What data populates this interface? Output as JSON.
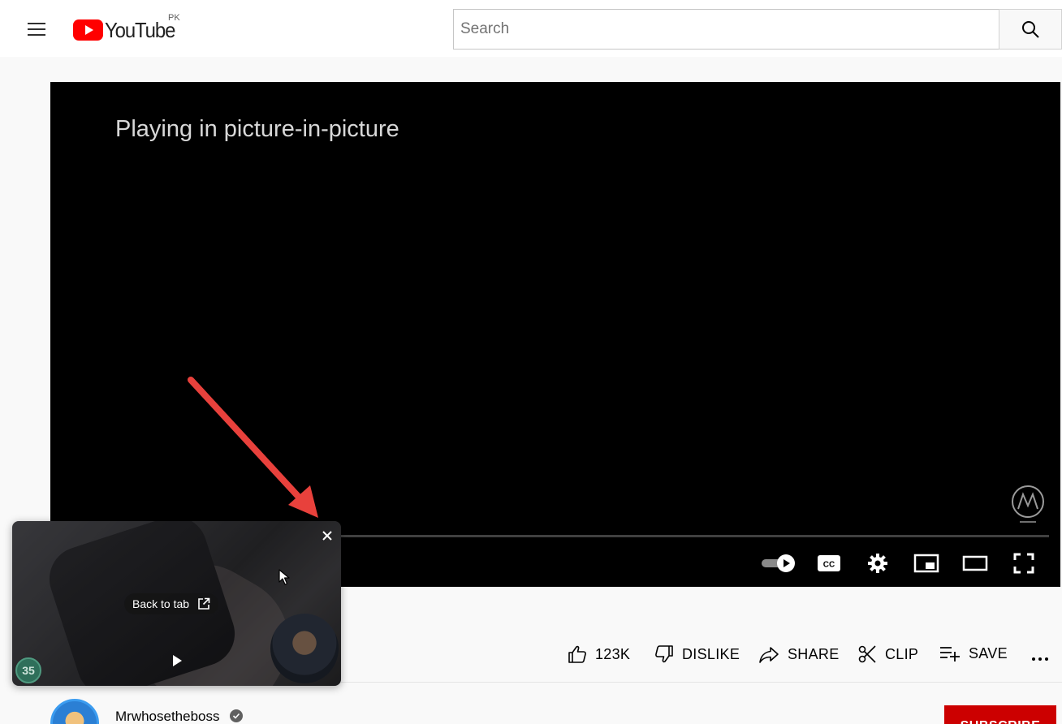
{
  "header": {
    "logo_text": "YouTube",
    "country_code": "PK",
    "search_placeholder": "Search"
  },
  "player": {
    "pip_message": "Playing in picture-in-picture"
  },
  "actions": {
    "like_count": "123K",
    "dislike_label": "DISLIKE",
    "share_label": "SHARE",
    "clip_label": "CLIP",
    "save_label": "SAVE"
  },
  "channel": {
    "name": "Mrwhosetheboss",
    "subscribe_label": "SUBSCRIBE"
  },
  "pip_window": {
    "back_to_tab_label": "Back to tab",
    "badge_count": "35"
  },
  "colors": {
    "brand_red": "#ff0000",
    "subscribe_red": "#cc0000",
    "annotation_arrow": "#e8413c"
  }
}
